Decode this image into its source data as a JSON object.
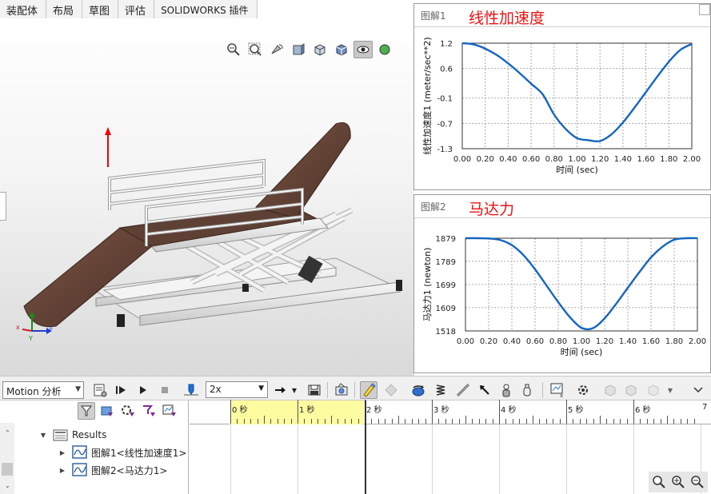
{
  "tabs": [
    "装配体",
    "布局",
    "草图",
    "评估",
    "SOLIDWORKS 插件"
  ],
  "view_toolbar": {
    "icons": [
      "zoom-to-fit-icon",
      "zoom-area-icon",
      "previous-view-icon",
      "section-view-icon",
      "view-orientation-icon",
      "display-style-icon",
      "hide-show-icon",
      "appearance-icon"
    ]
  },
  "graphs": [
    {
      "window_name": "图解1",
      "heading": "线性加速度",
      "ylabel": "线性加速度1 (meter/sec**2)",
      "xlabel": "时间 (sec)",
      "yticks": [
        "1.2",
        "0.6",
        "-0.1",
        "-0.7",
        "-1.3"
      ],
      "xticks": [
        "0.00",
        "0.20",
        "0.40",
        "0.60",
        "0.80",
        "1.00",
        "1.20",
        "1.40",
        "1.60",
        "1.80",
        "2.00"
      ]
    },
    {
      "window_name": "图解2",
      "heading": "马达力",
      "ylabel": "马达力1 (newton)",
      "xlabel": "时间 (sec)",
      "yticks": [
        "1879",
        "1789",
        "1699",
        "1609",
        "1518"
      ],
      "xticks": [
        "0.00",
        "0.20",
        "0.40",
        "0.60",
        "0.80",
        "1.00",
        "1.20",
        "1.40",
        "1.60",
        "1.80",
        "2.00"
      ]
    }
  ],
  "chart_data": [
    {
      "type": "line",
      "title": "线性加速度",
      "xlabel": "时间 (sec)",
      "ylabel": "线性加速度1 (meter/sec**2)",
      "xlim": [
        0,
        2
      ],
      "ylim": [
        -1.3,
        1.2
      ],
      "grid": true,
      "color": "#1565c0",
      "x": [
        0.0,
        0.1,
        0.2,
        0.3,
        0.4,
        0.5,
        0.6,
        0.7,
        0.8,
        0.9,
        1.0,
        1.1,
        1.2,
        1.3,
        1.4,
        1.5,
        1.6,
        1.7,
        1.8,
        1.9,
        2.0
      ],
      "y": [
        1.2,
        1.17,
        1.07,
        0.92,
        0.72,
        0.49,
        0.24,
        -0.01,
        -0.49,
        -0.83,
        -1.05,
        -1.1,
        -1.12,
        -0.96,
        -0.68,
        -0.33,
        0.04,
        0.41,
        0.76,
        1.04,
        1.18
      ]
    },
    {
      "type": "line",
      "title": "马达力",
      "xlabel": "时间 (sec)",
      "ylabel": "马达力1 (newton)",
      "xlim": [
        0,
        2
      ],
      "ylim": [
        1518,
        1879
      ],
      "grid": true,
      "color": "#1565c0",
      "x": [
        0.0,
        0.1,
        0.2,
        0.3,
        0.4,
        0.5,
        0.6,
        0.7,
        0.8,
        0.9,
        1.0,
        1.1,
        1.2,
        1.3,
        1.4,
        1.5,
        1.6,
        1.7,
        1.8,
        1.9,
        2.0
      ],
      "y": [
        1879,
        1879,
        1878,
        1872,
        1852,
        1813,
        1758,
        1694,
        1630,
        1572,
        1530,
        1529,
        1567,
        1624,
        1686,
        1747,
        1804,
        1846,
        1873,
        1879,
        1879
      ]
    }
  ],
  "motion_bar": {
    "study_type": "Motion 分析",
    "playback_speed": "2x"
  },
  "tree": {
    "results_label": "Results",
    "items": [
      "图解1<线性加速度1>",
      "图解2<马达力1>"
    ]
  },
  "timeline": {
    "labels": [
      "0 秒",
      "1 秒",
      "2 秒",
      "3 秒",
      "4 秒",
      "5 秒",
      "6 秒",
      "7"
    ]
  },
  "colors": {
    "heading_red": "#ee1111",
    "curve_blue": "#1565c0",
    "timeline_yellow": "#fdfca0"
  }
}
